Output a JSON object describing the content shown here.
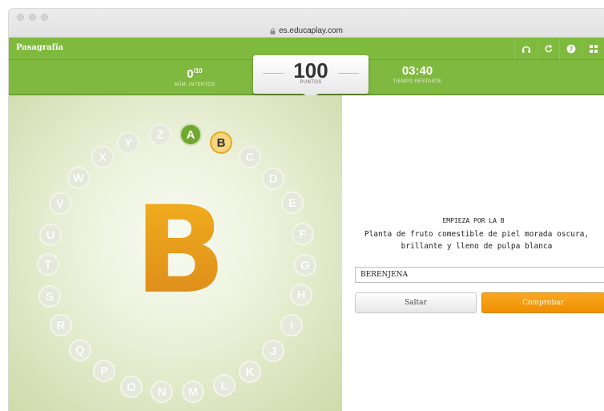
{
  "browser": {
    "url": "es.educaplay.com"
  },
  "app": {
    "title": "Pasagrafía",
    "icons": [
      "sound-icon",
      "restart-icon",
      "help-icon",
      "fullscreen-icon"
    ]
  },
  "stats": {
    "attempts_value": "0",
    "attempts_max": "/10",
    "attempts_label": "Núm. intentos",
    "points_value": "100",
    "points_label": "Puntos",
    "time_value": "03:40",
    "time_label": "Tiempo restante"
  },
  "game": {
    "current_letter": "B",
    "letters": {
      "A": "A",
      "B": "B",
      "C": "C",
      "D": "D",
      "E": "E",
      "F": "F",
      "G": "G",
      "H": "H",
      "I": "I",
      "J": "J",
      "K": "K",
      "L": "L",
      "M": "M",
      "N": "N",
      "O": "O",
      "P": "P",
      "Q": "Q",
      "R": "R",
      "S": "S",
      "T": "T",
      "U": "U",
      "V": "V",
      "W": "W",
      "X": "X",
      "Y": "Y",
      "Z": "Z"
    },
    "done_letters": [
      "A"
    ],
    "active_letter": "B"
  },
  "question": {
    "heading": "EMPIEZA POR LA B",
    "text": "Planta de fruto comestible de piel morada oscura, brillante y lleno de pulpa blanca",
    "answer_value": "BERENJENA"
  },
  "buttons": {
    "skip": "Saltar",
    "check": "Comprobar"
  },
  "colors": {
    "header_green": "#7fb93e",
    "done_green": "#6ea82d",
    "active_yellow": "#f5d57d",
    "orange": "#ef8f00"
  }
}
